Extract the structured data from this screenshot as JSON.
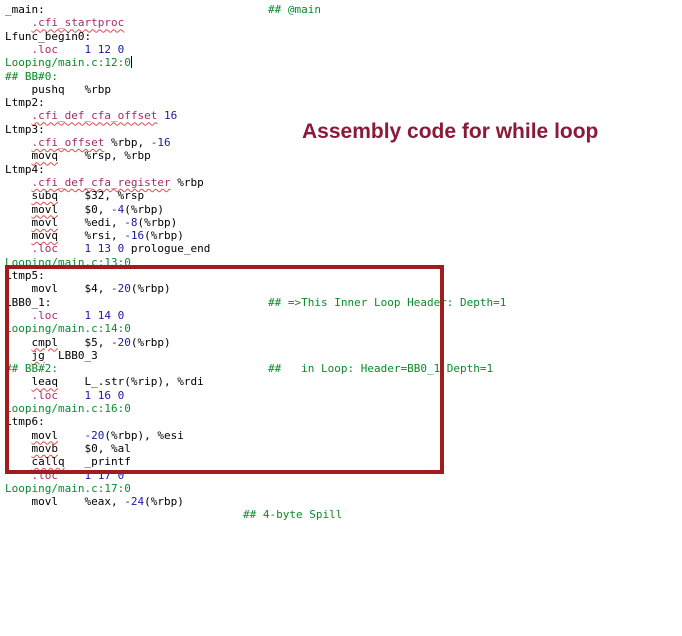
{
  "annotation": {
    "text": "Assembly code for while loop",
    "color": "#8b1a3a"
  },
  "highlight_box_color": "#a11c1c",
  "colors": {
    "directive": "#a52a6b",
    "number": "#1a1aa6",
    "green": "#0a8a2a",
    "squiggle": "#e34b4b"
  },
  "code": [
    {
      "tokens": [
        {
          "t": "_main:",
          "k": "normal"
        }
      ]
    },
    {
      "tokens": [
        {
          "t": "    ",
          "k": "normal"
        },
        {
          "t": ".cfi_startproc",
          "k": "dir",
          "sq": true
        }
      ]
    },
    {
      "tokens": [
        {
          "t": "Lfunc_begin0:",
          "k": "normal"
        }
      ]
    },
    {
      "tokens": [
        {
          "t": "    ",
          "k": "normal"
        },
        {
          "t": ".loc",
          "k": "dir"
        },
        {
          "t": "    1 12 0",
          "k": "num"
        }
      ]
    },
    {
      "tokens": [
        {
          "t": "Looping/main.c:12:0",
          "k": "green"
        }
      ],
      "cursor": true
    },
    {
      "tokens": [
        {
          "t": "## BB#0:",
          "k": "green"
        }
      ]
    },
    {
      "tokens": [
        {
          "t": "    pushq   %rbp",
          "k": "normal"
        }
      ]
    },
    {
      "tokens": [
        {
          "t": "Ltmp2:",
          "k": "normal"
        }
      ]
    },
    {
      "tokens": [
        {
          "t": "    ",
          "k": "normal"
        },
        {
          "t": ".cfi_def_cfa_offset",
          "k": "dir",
          "sq": true
        },
        {
          "t": " 16",
          "k": "num"
        }
      ]
    },
    {
      "tokens": [
        {
          "t": "Ltmp3:",
          "k": "normal"
        }
      ]
    },
    {
      "tokens": [
        {
          "t": "    ",
          "k": "normal"
        },
        {
          "t": ".cfi_offset",
          "k": "dir",
          "sq": true
        },
        {
          "t": " %rbp, ",
          "k": "normal"
        },
        {
          "t": "-16",
          "k": "num"
        }
      ]
    },
    {
      "tokens": [
        {
          "t": "    ",
          "k": "normal"
        },
        {
          "t": "movq",
          "k": "normal",
          "sq": true
        },
        {
          "t": "    %rsp, %rbp",
          "k": "normal"
        }
      ]
    },
    {
      "tokens": [
        {
          "t": "Ltmp4:",
          "k": "normal"
        }
      ]
    },
    {
      "tokens": [
        {
          "t": "    ",
          "k": "normal"
        },
        {
          "t": ".cfi_def_cfa_register",
          "k": "dir",
          "sq": true
        },
        {
          "t": " %rbp",
          "k": "normal"
        }
      ]
    },
    {
      "tokens": [
        {
          "t": "    ",
          "k": "normal"
        },
        {
          "t": "subq",
          "k": "normal",
          "sq": true
        },
        {
          "t": "    $32, %rsp",
          "k": "normal"
        }
      ]
    },
    {
      "tokens": [
        {
          "t": "    ",
          "k": "normal"
        },
        {
          "t": "movl",
          "k": "normal",
          "sq": true
        },
        {
          "t": "    $0, ",
          "k": "normal"
        },
        {
          "t": "-4",
          "k": "num"
        },
        {
          "t": "(%rbp)",
          "k": "normal"
        }
      ]
    },
    {
      "tokens": [
        {
          "t": "    ",
          "k": "normal"
        },
        {
          "t": "movl",
          "k": "normal",
          "sq": true
        },
        {
          "t": "    %edi, ",
          "k": "normal"
        },
        {
          "t": "-8",
          "k": "num"
        },
        {
          "t": "(%rbp)",
          "k": "normal"
        }
      ]
    },
    {
      "tokens": [
        {
          "t": "    ",
          "k": "normal"
        },
        {
          "t": "movq",
          "k": "normal",
          "sq": true
        },
        {
          "t": "    %rsi, ",
          "k": "normal"
        },
        {
          "t": "-16",
          "k": "num"
        },
        {
          "t": "(%rbp)",
          "k": "normal"
        }
      ]
    },
    {
      "tokens": [
        {
          "t": "    ",
          "k": "normal"
        },
        {
          "t": ".loc",
          "k": "dir"
        },
        {
          "t": "    1 13 0",
          "k": "num"
        },
        {
          "t": " prologue_end",
          "k": "normal"
        }
      ]
    },
    {
      "tokens": [
        {
          "t": "Looping/main.c:13:0",
          "k": "green"
        }
      ]
    },
    {
      "tokens": [
        {
          "t": "Ltmp5:",
          "k": "normal"
        }
      ]
    },
    {
      "tokens": [
        {
          "t": "    movl    $4, ",
          "k": "normal"
        },
        {
          "t": "-20",
          "k": "num"
        },
        {
          "t": "(%rbp)",
          "k": "normal"
        }
      ]
    },
    {
      "tokens": [
        {
          "t": "LBB0_1:",
          "k": "normal"
        }
      ]
    },
    {
      "tokens": [
        {
          "t": "    ",
          "k": "normal"
        },
        {
          "t": ".loc",
          "k": "dir"
        },
        {
          "t": "    1 14 0",
          "k": "num"
        }
      ]
    },
    {
      "tokens": [
        {
          "t": "Looping/main.c:14:0",
          "k": "green"
        }
      ]
    },
    {
      "tokens": [
        {
          "t": "    ",
          "k": "normal"
        },
        {
          "t": "cmpl",
          "k": "normal",
          "sq": true
        },
        {
          "t": "    $5, ",
          "k": "normal"
        },
        {
          "t": "-20",
          "k": "num"
        },
        {
          "t": "(%rbp)",
          "k": "normal"
        }
      ]
    },
    {
      "tokens": [
        {
          "t": "    ",
          "k": "normal"
        },
        {
          "t": "jg",
          "k": "normal",
          "sq": true
        },
        {
          "t": "  LBB0_3",
          "k": "normal"
        }
      ]
    },
    {
      "tokens": [
        {
          "t": "## BB#2:",
          "k": "green"
        }
      ]
    },
    {
      "tokens": [
        {
          "t": "    ",
          "k": "normal"
        },
        {
          "t": "leaq",
          "k": "normal",
          "sq": true
        },
        {
          "t": "    L_.str(%rip), %rdi",
          "k": "normal"
        }
      ]
    },
    {
      "tokens": [
        {
          "t": "    ",
          "k": "normal"
        },
        {
          "t": ".loc",
          "k": "dir"
        },
        {
          "t": "    1 16 0",
          "k": "num"
        }
      ]
    },
    {
      "tokens": [
        {
          "t": "Looping/main.c:16:0",
          "k": "green"
        }
      ]
    },
    {
      "tokens": [
        {
          "t": "Ltmp6:",
          "k": "normal"
        }
      ]
    },
    {
      "tokens": [
        {
          "t": "    ",
          "k": "normal"
        },
        {
          "t": "movl",
          "k": "normal",
          "sq": true
        },
        {
          "t": "    ",
          "k": "normal"
        },
        {
          "t": "-20",
          "k": "num"
        },
        {
          "t": "(%rbp), %esi",
          "k": "normal"
        }
      ]
    },
    {
      "tokens": [
        {
          "t": "    ",
          "k": "normal"
        },
        {
          "t": "movb",
          "k": "normal",
          "sq": true
        },
        {
          "t": "    $0, %al",
          "k": "normal"
        }
      ]
    },
    {
      "tokens": [
        {
          "t": "    ",
          "k": "normal"
        },
        {
          "t": "callq",
          "k": "normal",
          "sq": true
        },
        {
          "t": "   _printf",
          "k": "normal"
        }
      ]
    },
    {
      "tokens": [
        {
          "t": "    ",
          "k": "normal"
        },
        {
          "t": ".loc",
          "k": "dir"
        },
        {
          "t": "    1 17 0",
          "k": "num"
        }
      ]
    },
    {
      "tokens": [
        {
          "t": "Looping/main.c:17:0",
          "k": "green"
        }
      ]
    },
    {
      "tokens": [
        {
          "t": "    movl    %eax, ",
          "k": "normal"
        },
        {
          "t": "-24",
          "k": "num"
        },
        {
          "t": "(%rbp)",
          "k": "normal"
        }
      ]
    }
  ],
  "comments": [
    {
      "line": 0,
      "text": "## @main"
    },
    {
      "line": 22,
      "text": "## =>This Inner Loop Header: Depth=1"
    },
    {
      "line": 27,
      "text": "##   in Loop: Header=BB0_1 Depth=1"
    },
    {
      "line": 38,
      "text": "## 4-byte Spill"
    }
  ]
}
